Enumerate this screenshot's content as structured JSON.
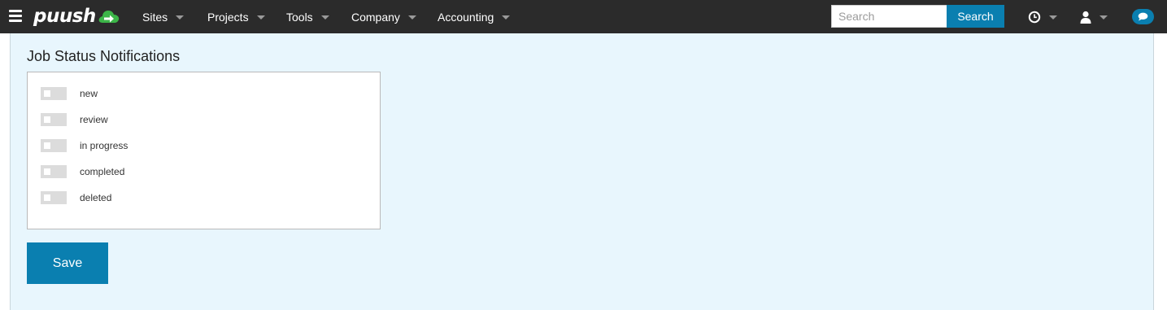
{
  "header": {
    "logo_text": "puush",
    "nav": [
      {
        "label": "Sites"
      },
      {
        "label": "Projects"
      },
      {
        "label": "Tools"
      },
      {
        "label": "Company"
      },
      {
        "label": "Accounting"
      }
    ],
    "search": {
      "placeholder": "Search",
      "value": "",
      "button_label": "Search"
    },
    "icons": {
      "menu": "hamburger-icon",
      "history": "clock-icon",
      "user": "user-icon",
      "chat": "chat-bubble-icon"
    }
  },
  "main": {
    "section_title": "Job Status Notifications",
    "toggles": [
      {
        "label": "new",
        "on": false
      },
      {
        "label": "review",
        "on": false
      },
      {
        "label": "in progress",
        "on": false
      },
      {
        "label": "completed",
        "on": false
      },
      {
        "label": "deleted",
        "on": false
      }
    ],
    "save_label": "Save"
  },
  "colors": {
    "topbar": "#2b2b2b",
    "accent": "#0a7fb0",
    "logo_green": "#3cb548",
    "panel_bg": "#e8f6fd",
    "toggle_off": "#dcdcdc"
  }
}
